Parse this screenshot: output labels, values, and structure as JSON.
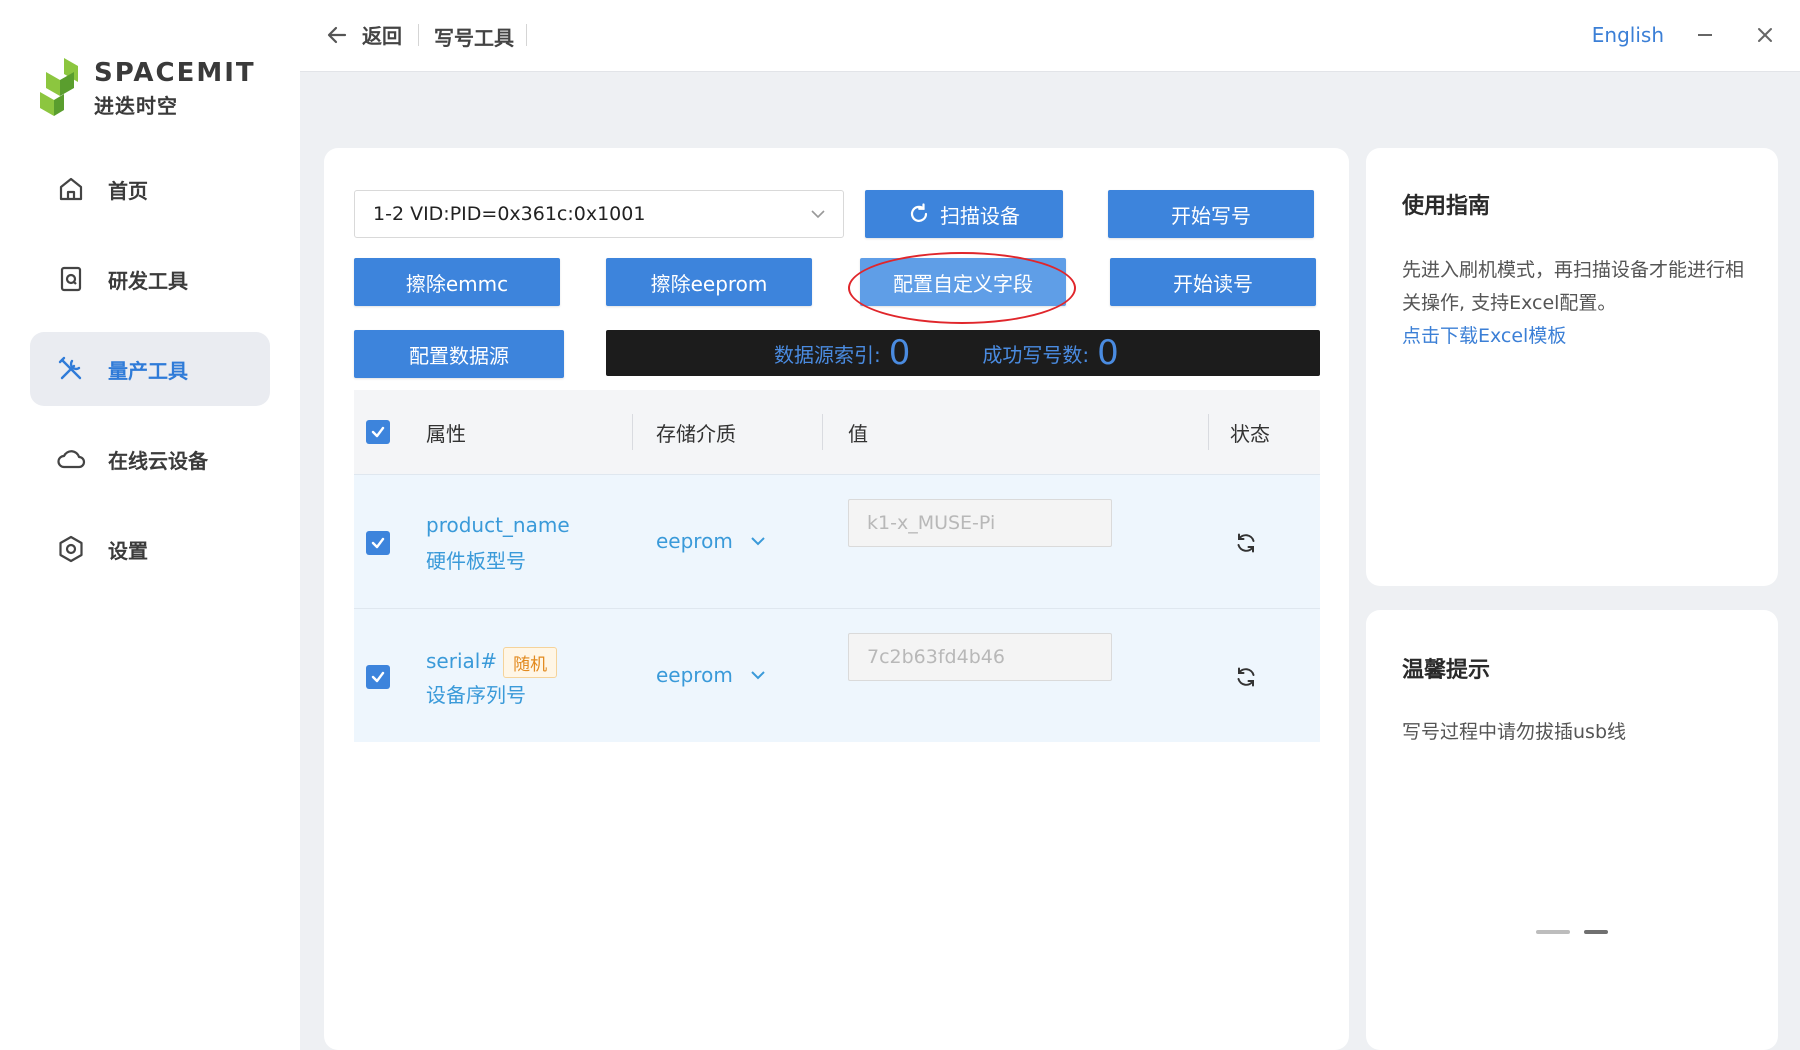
{
  "brand": {
    "name": "SPACEMIT",
    "sub": "进迭时空",
    "colors": {
      "green": "#8cc63f",
      "dark_green": "#5a9e2e"
    }
  },
  "sidebar": {
    "items": [
      {
        "label": "首页",
        "icon": "home-icon",
        "active": false
      },
      {
        "label": "研发工具",
        "icon": "dev-tool-icon",
        "active": false
      },
      {
        "label": "量产工具",
        "icon": "wrench-cross-icon",
        "active": true
      },
      {
        "label": "在线云设备",
        "icon": "cloud-icon",
        "active": false
      },
      {
        "label": "设置",
        "icon": "settings-hex-icon",
        "active": false
      }
    ]
  },
  "topbar": {
    "back_label": "返回",
    "title": "写号工具",
    "language": "English"
  },
  "main": {
    "device_select": "1-2 VID:PID=0x361c:0x1001",
    "buttons": {
      "scan": "扫描设备",
      "start_write": "开始写号",
      "erase_emmc": "擦除emmc",
      "erase_eeprom": "擦除eeprom",
      "config_custom": "配置自定义字段",
      "start_read": "开始读号",
      "config_source": "配置数据源"
    },
    "status": {
      "index_label": "数据源索引:",
      "index_value": "0",
      "success_label": "成功写号数:",
      "success_value": "0"
    },
    "table": {
      "headers": {
        "attr": "属性",
        "media": "存储介质",
        "value": "值",
        "state": "状态"
      },
      "rows": [
        {
          "name": "product_name",
          "desc": "硬件板型号",
          "media": "eeprom",
          "value": "k1-x_MUSE-Pi",
          "tag": ""
        },
        {
          "name": "serial#",
          "desc": "设备序列号",
          "media": "eeprom",
          "value": "7c2b63fd4b46",
          "tag": "随机"
        }
      ]
    }
  },
  "guide": {
    "title": "使用指南",
    "text": "先进入刷机模式，再扫描设备才能进行相关操作, 支持Excel配置。",
    "link": "点击下载Excel模板"
  },
  "tips": {
    "title": "温馨提示",
    "text": "写号过程中请勿拔插usb线"
  },
  "accent": "#3d84dc"
}
